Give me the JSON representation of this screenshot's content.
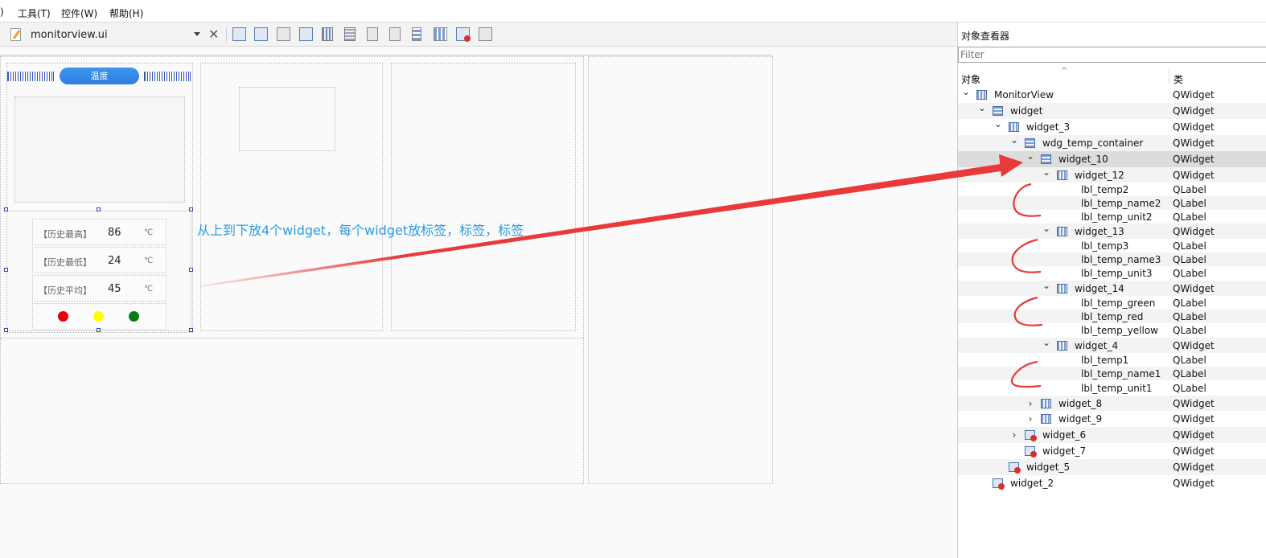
{
  "menu": {
    "items": [
      ")",
      "工具(T)",
      "控件(W)",
      "帮助(H)"
    ]
  },
  "toolbar": {
    "filename": "monitorview.ui",
    "close_label": "✕"
  },
  "form": {
    "temp_title": "温度",
    "rows": [
      {
        "label": "【历史最高】",
        "value": "86",
        "unit": "℃"
      },
      {
        "label": "【历史最低】",
        "value": "24",
        "unit": "℃"
      },
      {
        "label": "【历史平均】",
        "value": "45",
        "unit": "℃"
      }
    ],
    "lights": [
      "#e8000b",
      "#ffff00",
      "#0a7d12"
    ]
  },
  "annotation": {
    "text": "从上到下放4个widget，每个widget放标签，标签，标签",
    "color": "#2a9ae0",
    "arrow_color": "#e83a3a"
  },
  "inspector": {
    "title": "对象查看器",
    "filter_placeholder": "Filter",
    "col_object": "对象",
    "col_class": "类",
    "rows": [
      {
        "name": "MonitorView",
        "cls": "QWidget",
        "depth": 0,
        "chev": "⌄",
        "icon": "hbox"
      },
      {
        "name": "widget",
        "cls": "QWidget",
        "depth": 1,
        "chev": "⌄",
        "icon": "vbox"
      },
      {
        "name": "widget_3",
        "cls": "QWidget",
        "depth": 2,
        "chev": "⌄",
        "icon": "hbox"
      },
      {
        "name": "wdg_temp_container",
        "cls": "QWidget",
        "depth": 3,
        "chev": "⌄",
        "icon": "vbox"
      },
      {
        "name": "widget_10",
        "cls": "QWidget",
        "depth": 4,
        "chev": "⌄",
        "icon": "vbox",
        "selected": true
      },
      {
        "name": "widget_12",
        "cls": "QWidget",
        "depth": 5,
        "chev": "⌄",
        "icon": "hbox"
      },
      {
        "name": "lbl_temp2",
        "cls": "QLabel",
        "depth": 6,
        "chev": "",
        "icon": ""
      },
      {
        "name": "lbl_temp_name2",
        "cls": "QLabel",
        "depth": 6,
        "chev": "",
        "icon": ""
      },
      {
        "name": "lbl_temp_unit2",
        "cls": "QLabel",
        "depth": 6,
        "chev": "",
        "icon": ""
      },
      {
        "name": "widget_13",
        "cls": "QWidget",
        "depth": 5,
        "chev": "⌄",
        "icon": "hbox"
      },
      {
        "name": "lbl_temp3",
        "cls": "QLabel",
        "depth": 6,
        "chev": "",
        "icon": ""
      },
      {
        "name": "lbl_temp_name3",
        "cls": "QLabel",
        "depth": 6,
        "chev": "",
        "icon": ""
      },
      {
        "name": "lbl_temp_unit3",
        "cls": "QLabel",
        "depth": 6,
        "chev": "",
        "icon": ""
      },
      {
        "name": "widget_14",
        "cls": "QWidget",
        "depth": 5,
        "chev": "⌄",
        "icon": "hbox"
      },
      {
        "name": "lbl_temp_green",
        "cls": "QLabel",
        "depth": 6,
        "chev": "",
        "icon": ""
      },
      {
        "name": "lbl_temp_red",
        "cls": "QLabel",
        "depth": 6,
        "chev": "",
        "icon": ""
      },
      {
        "name": "lbl_temp_yellow",
        "cls": "QLabel",
        "depth": 6,
        "chev": "",
        "icon": ""
      },
      {
        "name": "widget_4",
        "cls": "QWidget",
        "depth": 5,
        "chev": "⌄",
        "icon": "hbox"
      },
      {
        "name": "lbl_temp1",
        "cls": "QLabel",
        "depth": 6,
        "chev": "",
        "icon": ""
      },
      {
        "name": "lbl_temp_name1",
        "cls": "QLabel",
        "depth": 6,
        "chev": "",
        "icon": ""
      },
      {
        "name": "lbl_temp_unit1",
        "cls": "QLabel",
        "depth": 6,
        "chev": "",
        "icon": ""
      },
      {
        "name": "widget_8",
        "cls": "QWidget",
        "depth": 4,
        "chev": "›",
        "icon": "hbox"
      },
      {
        "name": "widget_9",
        "cls": "QWidget",
        "depth": 4,
        "chev": "›",
        "icon": "hbox"
      },
      {
        "name": "widget_6",
        "cls": "QWidget",
        "depth": 3,
        "chev": "›",
        "icon": "form"
      },
      {
        "name": "widget_7",
        "cls": "QWidget",
        "depth": 3,
        "chev": "",
        "icon": "form"
      },
      {
        "name": "widget_5",
        "cls": "QWidget",
        "depth": 2,
        "chev": "",
        "icon": "form"
      },
      {
        "name": "widget_2",
        "cls": "QWidget",
        "depth": 1,
        "chev": "",
        "icon": "form"
      }
    ]
  }
}
